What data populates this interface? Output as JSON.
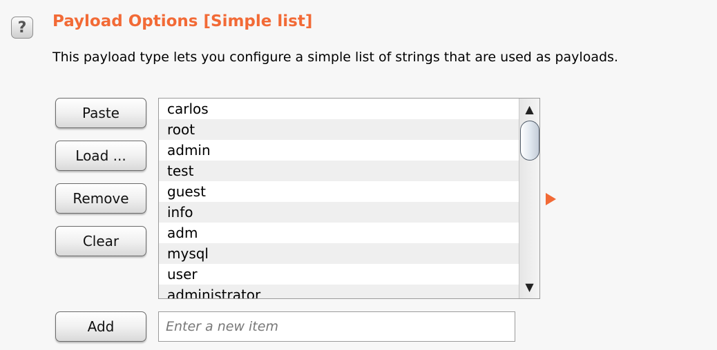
{
  "help": {
    "glyph": "?"
  },
  "section": {
    "title": "Payload Options [Simple list]",
    "description": "This payload type lets you configure a simple list of strings that are used as payloads."
  },
  "buttons": {
    "paste": "Paste",
    "load": "Load ...",
    "remove": "Remove",
    "clear": "Clear",
    "add": "Add"
  },
  "list": {
    "items": [
      "carlos",
      "root",
      "admin",
      "test",
      "guest",
      "info",
      "adm",
      "mysql",
      "user",
      "administrator"
    ]
  },
  "scrollbar": {
    "up_glyph": "▲",
    "down_glyph": "▼"
  },
  "new_item": {
    "placeholder": "Enter a new item",
    "value": ""
  },
  "colors": {
    "accent": "#f26a36",
    "row_alt": "#efefef"
  }
}
